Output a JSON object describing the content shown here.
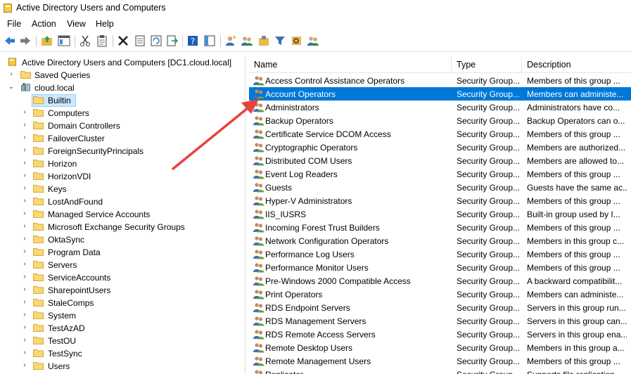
{
  "window": {
    "title": "Active Directory Users and Computers"
  },
  "menu": {
    "file": "File",
    "action": "Action",
    "view": "View",
    "help": "Help"
  },
  "tree": {
    "root": "Active Directory Users and Computers [DC1.cloud.local]",
    "saved_queries": "Saved Queries",
    "domain": "cloud.local",
    "items": [
      "Builtin",
      "Computers",
      "Domain Controllers",
      "FailoverCluster",
      "ForeignSecurityPrincipals",
      "Horizon",
      "HorizonVDI",
      "Keys",
      "LostAndFound",
      "Managed Service Accounts",
      "Microsoft Exchange Security Groups",
      "OktaSync",
      "Program Data",
      "Servers",
      "ServiceAccounts",
      "SharepointUsers",
      "StaleComps",
      "System",
      "TestAzAD",
      "TestOU",
      "TestSync",
      "Users"
    ],
    "selected": "Builtin"
  },
  "list": {
    "headers": {
      "name": "Name",
      "type": "Type",
      "description": "Description"
    },
    "rows": [
      [
        "Access Control Assistance Operators",
        "Security Group...",
        "Members of this group ..."
      ],
      [
        "Account Operators",
        "Security Group...",
        "Members can administe..."
      ],
      [
        "Administrators",
        "Security Group...",
        "Administrators have co..."
      ],
      [
        "Backup Operators",
        "Security Group...",
        "Backup Operators can o..."
      ],
      [
        "Certificate Service DCOM Access",
        "Security Group...",
        "Members of this group ..."
      ],
      [
        "Cryptographic Operators",
        "Security Group...",
        "Members are authorized..."
      ],
      [
        "Distributed COM Users",
        "Security Group...",
        "Members are allowed to..."
      ],
      [
        "Event Log Readers",
        "Security Group...",
        "Members of this group ..."
      ],
      [
        "Guests",
        "Security Group...",
        "Guests have the same ac..."
      ],
      [
        "Hyper-V Administrators",
        "Security Group...",
        "Members of this group ..."
      ],
      [
        "IIS_IUSRS",
        "Security Group...",
        "Built-in group used by I..."
      ],
      [
        "Incoming Forest Trust Builders",
        "Security Group...",
        "Members of this group ..."
      ],
      [
        "Network Configuration Operators",
        "Security Group...",
        "Members in this group c..."
      ],
      [
        "Performance Log Users",
        "Security Group...",
        "Members of this group ..."
      ],
      [
        "Performance Monitor Users",
        "Security Group...",
        "Members of this group ..."
      ],
      [
        "Pre-Windows 2000 Compatible Access",
        "Security Group...",
        "A backward compatibilit..."
      ],
      [
        "Print Operators",
        "Security Group...",
        "Members can administe..."
      ],
      [
        "RDS Endpoint Servers",
        "Security Group...",
        "Servers in this group run..."
      ],
      [
        "RDS Management Servers",
        "Security Group...",
        "Servers in this group can..."
      ],
      [
        "RDS Remote Access Servers",
        "Security Group...",
        "Servers in this group ena..."
      ],
      [
        "Remote Desktop Users",
        "Security Group...",
        "Members in this group a..."
      ],
      [
        "Remote Management Users",
        "Security Group...",
        "Members of this group ..."
      ],
      [
        "Replicator",
        "Security Group...",
        "Supports file replication..."
      ]
    ],
    "selected_index": 1
  },
  "colors": {
    "selection": "#0078d7",
    "tree_selection": "#cde8ff",
    "annotation_arrow": "#e8413b"
  }
}
